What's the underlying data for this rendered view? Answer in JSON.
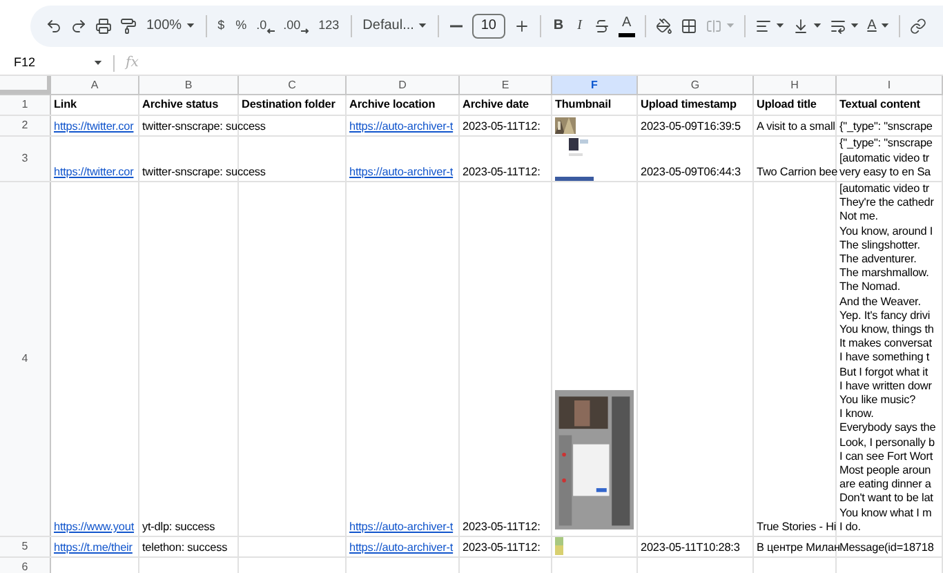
{
  "toolbar": {
    "items": [
      {
        "kind": "undo"
      },
      {
        "kind": "redo"
      },
      {
        "kind": "print"
      },
      {
        "kind": "paint_format"
      },
      {
        "kind": "dropdown",
        "label": "100%"
      },
      {
        "kind": "separator"
      },
      {
        "kind": "text",
        "label": "$"
      },
      {
        "kind": "text",
        "label": "%"
      },
      {
        "kind": "decimal_decrease",
        "label": ".0"
      },
      {
        "kind": "decimal_increase",
        "label": ".00"
      },
      {
        "kind": "text",
        "label": "123"
      },
      {
        "kind": "separator"
      },
      {
        "kind": "dropdown",
        "label": "Defaul..."
      },
      {
        "kind": "separator"
      },
      {
        "kind": "minus"
      },
      {
        "kind": "field",
        "value": "10"
      },
      {
        "kind": "plus"
      },
      {
        "kind": "separator"
      },
      {
        "kind": "bold",
        "label": "B"
      },
      {
        "kind": "italic",
        "label": "I"
      },
      {
        "kind": "strikethrough"
      },
      {
        "kind": "text_color",
        "label": "A"
      },
      {
        "kind": "separator"
      },
      {
        "kind": "fill_color"
      },
      {
        "kind": "borders"
      },
      {
        "kind": "merge",
        "disabled": true
      },
      {
        "kind": "separator"
      },
      {
        "kind": "align"
      },
      {
        "kind": "valign"
      },
      {
        "kind": "wrap"
      },
      {
        "kind": "rotate",
        "label": "A"
      },
      {
        "kind": "separator"
      },
      {
        "kind": "link"
      }
    ]
  },
  "formula_bar": {
    "cell_ref": "F12",
    "fx": "fx"
  },
  "columns": [
    {
      "letter": "A",
      "selected": false
    },
    {
      "letter": "B",
      "selected": false
    },
    {
      "letter": "C",
      "selected": false
    },
    {
      "letter": "D",
      "selected": false
    },
    {
      "letter": "E",
      "selected": false
    },
    {
      "letter": "F",
      "selected": true
    },
    {
      "letter": "G",
      "selected": false
    },
    {
      "letter": "H",
      "selected": false
    },
    {
      "letter": "I",
      "selected": false
    }
  ],
  "rows": [
    {
      "number": "1",
      "kind": "header",
      "cells": [
        {
          "text": "Link"
        },
        {
          "text": "Archive status"
        },
        {
          "text": "Destination folder"
        },
        {
          "text": "Archive location"
        },
        {
          "text": "Archive date"
        },
        {
          "text": "Thumbnail"
        },
        {
          "text": "Upload timestamp"
        },
        {
          "text": "Upload title"
        },
        {
          "text": "Textual content"
        }
      ]
    },
    {
      "number": "2",
      "kind": "data",
      "cells": [
        {
          "kind": "link",
          "text": "https://twitter.cor"
        },
        {
          "kind": "text",
          "text": "twitter-snscrape: success"
        },
        {
          "kind": "empty"
        },
        {
          "kind": "link",
          "text": "https://auto-archiver-t"
        },
        {
          "kind": "text",
          "text": "2023-05-11T12:"
        },
        {
          "kind": "picture"
        },
        {
          "kind": "text",
          "text": "2023-05-09T16:39:5"
        },
        {
          "kind": "text",
          "text": "A visit to a small"
        },
        {
          "kind": "text",
          "text": "{\"_type\": \"snscrape"
        }
      ]
    },
    {
      "number": "3",
      "kind": "data",
      "cells": [
        {
          "kind": "link",
          "text": "https://twitter.cor"
        },
        {
          "kind": "text",
          "text": "twitter-snscrape: success"
        },
        {
          "kind": "empty"
        },
        {
          "kind": "link",
          "text": "https://auto-archiver-t"
        },
        {
          "kind": "text",
          "text": "2023-05-11T12:"
        },
        {
          "kind": "picture"
        },
        {
          "kind": "text",
          "text": "2023-05-09T06:44:3"
        },
        {
          "kind": "text",
          "text": "Two Carrion bee"
        },
        {
          "kind": "text",
          "text": "{\"_type\": \"snscrape\n[automatic video tr\nvery easy to en Sa"
        }
      ]
    },
    {
      "number": "4",
      "kind": "data",
      "cells": [
        {
          "kind": "link",
          "text": "https://www.yout"
        },
        {
          "kind": "text",
          "text": "yt-dlp: success"
        },
        {
          "kind": "empty"
        },
        {
          "kind": "link",
          "text": "https://auto-archiver-t"
        },
        {
          "kind": "text",
          "text": "2023-05-11T12:"
        },
        {
          "kind": "picture"
        },
        {
          "kind": "empty"
        },
        {
          "kind": "text",
          "text": "True Stories - Hi"
        },
        {
          "kind": "text",
          "text": "[automatic video tr\nThey're the cathedr\nNot me.\nYou know, around I\nThe slingshotter.\nThe adventurer.\nThe marshmallow.\nThe Nomad.\nAnd the Weaver.\nYep. It's fancy drivi\nYou know, things th\nIt makes conversat\nI have something t\nBut I forgot what it\nI have written dowr\nYou like music?\nI know.\nEverybody says the\nLook, I personally b\nI can see Fort Wort\nMost people aroun\nare eating dinner a\nDon't want to be lat\nYou know what I m\nI do."
        }
      ]
    },
    {
      "number": "5",
      "kind": "data",
      "cells": [
        {
          "kind": "link",
          "text": "https://t.me/their"
        },
        {
          "kind": "text",
          "text": "telethon: success"
        },
        {
          "kind": "empty"
        },
        {
          "kind": "link",
          "text": "https://auto-archiver-t"
        },
        {
          "kind": "text",
          "text": "2023-05-11T12:"
        },
        {
          "kind": "picture"
        },
        {
          "kind": "text",
          "text": "2023-05-11T10:28:3"
        },
        {
          "kind": "text",
          "text": "В центре Милан"
        },
        {
          "kind": "text",
          "text": "Message(id=18718"
        }
      ]
    },
    {
      "number": "6",
      "kind": "data",
      "cells": [
        {
          "kind": "empty"
        },
        {
          "kind": "empty"
        },
        {
          "kind": "empty"
        },
        {
          "kind": "empty"
        },
        {
          "kind": "empty"
        },
        {
          "kind": "empty"
        },
        {
          "kind": "empty"
        },
        {
          "kind": "empty"
        },
        {
          "kind": "empty"
        }
      ]
    }
  ]
}
